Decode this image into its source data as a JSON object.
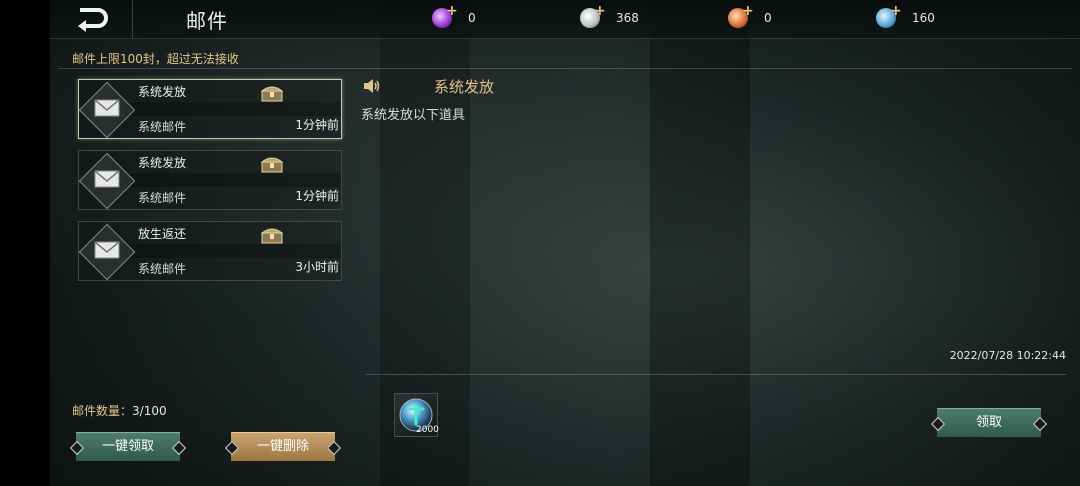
{
  "header": {
    "title": "邮件",
    "back_icon": "back-arrow-icon"
  },
  "currencies": [
    {
      "icon": "purple-gem-icon",
      "value": "0",
      "color": "#9b3fd6"
    },
    {
      "icon": "silver-coin-icon",
      "value": "368",
      "color": "#bfc3c6"
    },
    {
      "icon": "orange-orb-icon",
      "value": "0",
      "color": "#d9703a"
    },
    {
      "icon": "blue-orb-icon",
      "value": "160",
      "color": "#5aa8d8"
    }
  ],
  "mail_list": {
    "limit_note": "邮件上限100封，超过无法接收",
    "items": [
      {
        "subject": "系统发放",
        "sender": "系统邮件",
        "time": "1分钟前",
        "selected": true
      },
      {
        "subject": "系统发放",
        "sender": "系统邮件",
        "time": "1分钟前",
        "selected": false
      },
      {
        "subject": "放生返还",
        "sender": "系统邮件",
        "time": "3小时前",
        "selected": false
      }
    ],
    "count_label": "邮件数量：",
    "count_value": "3/100",
    "claim_all_label": "一键领取",
    "delete_all_label": "一键删除"
  },
  "detail": {
    "title": "系统发放",
    "body": "系统发放以下道具",
    "date": "2022/07/28 10:22:44",
    "attachment": {
      "icon": "blue-orb-item-icon",
      "quantity": "2000"
    },
    "claim_label": "领取"
  },
  "colors": {
    "gold_text": "#e2c98a",
    "green_button": "#3f6b5d",
    "gold_button": "#b38c57"
  }
}
